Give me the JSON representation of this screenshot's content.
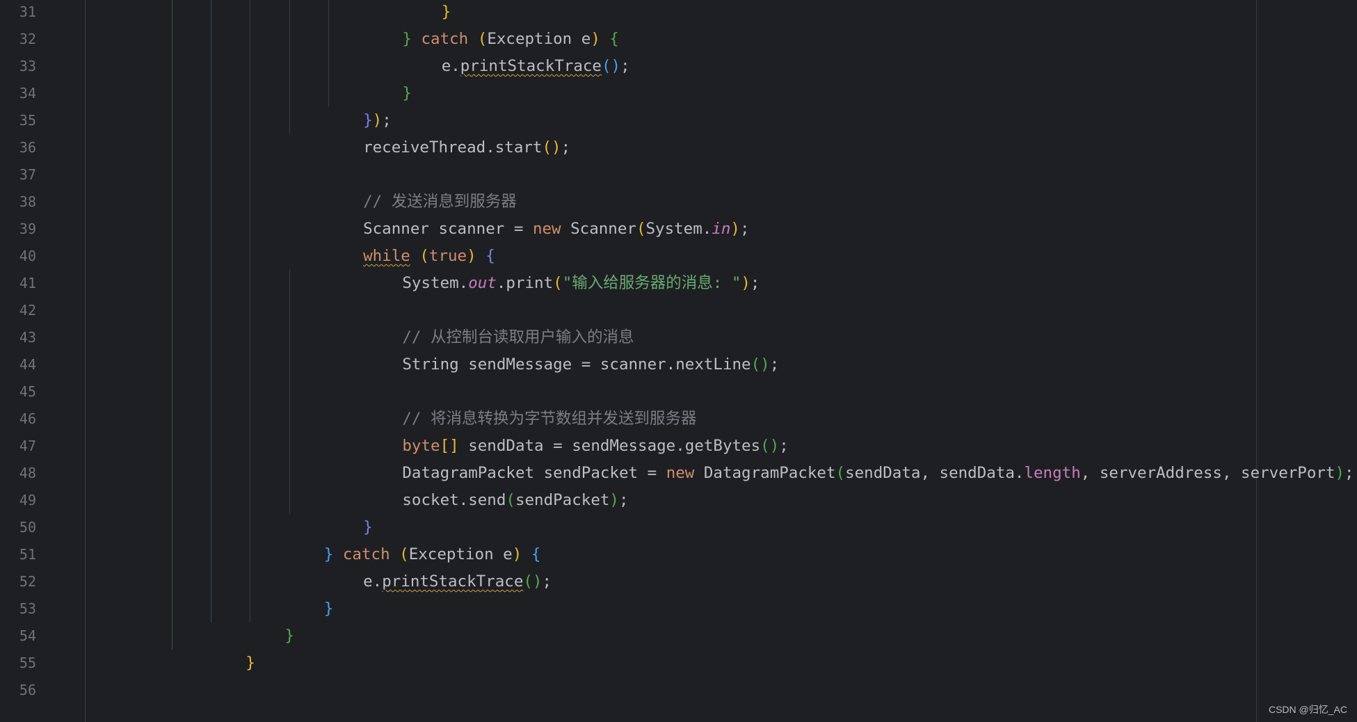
{
  "colors": {
    "background": "#1e1f22",
    "line_number": "#6f737a",
    "keyword": "#cf8e6d",
    "text": "#bcbec4",
    "string": "#6aab73",
    "comment": "#7a7e85",
    "static_field": "#c77dbb",
    "field": "#c77dbb",
    "brace_yellow": "#e8ba36",
    "brace_green": "#54a857",
    "brace_blue": "#4a9ff5",
    "brace_purple": "#7b83e6"
  },
  "editor": {
    "lines": [
      {
        "number": "31",
        "tokens": [
          {
            "text": "}",
            "class": "brace_yellow"
          }
        ]
      },
      {
        "number": "32",
        "tokens": [
          {
            "text": "} ",
            "class": "brace_green"
          },
          {
            "text": "catch ",
            "class": "keyword"
          },
          {
            "text": "(",
            "class": "brace_yellow"
          },
          {
            "text": "Exception e",
            "class": "text"
          },
          {
            "text": ") ",
            "class": "brace_yellow"
          },
          {
            "text": "{",
            "class": "brace_green"
          }
        ]
      },
      {
        "number": "33",
        "tokens": [
          {
            "text": "e.",
            "class": "text"
          },
          {
            "text": "printStackTrace",
            "class": "text",
            "squiggle": true
          },
          {
            "text": "()",
            "class": "brace_blue"
          },
          {
            "text": ";",
            "class": "text"
          }
        ]
      },
      {
        "number": "34",
        "tokens": [
          {
            "text": "}",
            "class": "brace_green"
          }
        ]
      },
      {
        "number": "35",
        "tokens": [
          {
            "text": "}",
            "class": "brace_purple"
          },
          {
            "text": ")",
            "class": "brace_yellow"
          },
          {
            "text": ";",
            "class": "text"
          }
        ]
      },
      {
        "number": "36",
        "tokens": [
          {
            "text": "receiveThread.start",
            "class": "text"
          },
          {
            "text": "()",
            "class": "brace_yellow"
          },
          {
            "text": ";",
            "class": "text"
          }
        ]
      },
      {
        "number": "37",
        "tokens": []
      },
      {
        "number": "38",
        "tokens": [
          {
            "text": "// 发送消息到服务器",
            "class": "comment"
          }
        ]
      },
      {
        "number": "39",
        "tokens": [
          {
            "text": "Scanner scanner = ",
            "class": "text"
          },
          {
            "text": "new ",
            "class": "keyword"
          },
          {
            "text": "Scanner",
            "class": "text"
          },
          {
            "text": "(",
            "class": "brace_yellow"
          },
          {
            "text": "System.",
            "class": "text"
          },
          {
            "text": "in",
            "class": "static_field",
            "italic": true
          },
          {
            "text": ")",
            "class": "brace_yellow"
          },
          {
            "text": ";",
            "class": "text"
          }
        ]
      },
      {
        "number": "40",
        "tokens": [
          {
            "text": "while",
            "class": "keyword",
            "squiggle": true
          },
          {
            "text": " ",
            "class": "text"
          },
          {
            "text": "(",
            "class": "brace_yellow"
          },
          {
            "text": "true",
            "class": "keyword"
          },
          {
            "text": ") ",
            "class": "brace_yellow"
          },
          {
            "text": "{",
            "class": "brace_purple"
          }
        ]
      },
      {
        "number": "41",
        "tokens": [
          {
            "text": "System.",
            "class": "text"
          },
          {
            "text": "out",
            "class": "static_field",
            "italic": true
          },
          {
            "text": ".print",
            "class": "text"
          },
          {
            "text": "(",
            "class": "brace_yellow"
          },
          {
            "text": "\"输入给服务器的消息: \"",
            "class": "string"
          },
          {
            "text": ")",
            "class": "brace_yellow"
          },
          {
            "text": ";",
            "class": "text"
          }
        ]
      },
      {
        "number": "42",
        "tokens": []
      },
      {
        "number": "43",
        "tokens": [
          {
            "text": "// 从控制台读取用户输入的消息",
            "class": "comment"
          }
        ]
      },
      {
        "number": "44",
        "tokens": [
          {
            "text": "String sendMessage = scanner.nextLine",
            "class": "text"
          },
          {
            "text": "()",
            "class": "brace_green"
          },
          {
            "text": ";",
            "class": "text"
          }
        ]
      },
      {
        "number": "45",
        "tokens": []
      },
      {
        "number": "46",
        "tokens": [
          {
            "text": "// 将消息转换为字节数组并发送到服务器",
            "class": "comment"
          }
        ]
      },
      {
        "number": "47",
        "tokens": [
          {
            "text": "byte",
            "class": "keyword"
          },
          {
            "text": "[]",
            "class": "brace_yellow"
          },
          {
            "text": " sendData = sendMessage.getBytes",
            "class": "text"
          },
          {
            "text": "()",
            "class": "brace_green"
          },
          {
            "text": ";",
            "class": "text"
          }
        ]
      },
      {
        "number": "48",
        "tokens": [
          {
            "text": "DatagramPacket sendPacket = ",
            "class": "text"
          },
          {
            "text": "new ",
            "class": "keyword"
          },
          {
            "text": "DatagramPacket",
            "class": "text"
          },
          {
            "text": "(",
            "class": "brace_green"
          },
          {
            "text": "sendData, sendData.",
            "class": "text"
          },
          {
            "text": "length",
            "class": "field"
          },
          {
            "text": ", serverAddress, serverPort",
            "class": "text"
          },
          {
            "text": ")",
            "class": "brace_green"
          },
          {
            "text": ";",
            "class": "text"
          }
        ]
      },
      {
        "number": "49",
        "tokens": [
          {
            "text": "socket.send",
            "class": "text"
          },
          {
            "text": "(",
            "class": "brace_green"
          },
          {
            "text": "sendPacket",
            "class": "text"
          },
          {
            "text": ")",
            "class": "brace_green"
          },
          {
            "text": ";",
            "class": "text"
          }
        ]
      },
      {
        "number": "50",
        "tokens": [
          {
            "text": "}",
            "class": "brace_purple"
          }
        ]
      },
      {
        "number": "51",
        "tokens": [
          {
            "text": "} ",
            "class": "brace_blue"
          },
          {
            "text": "catch ",
            "class": "keyword"
          },
          {
            "text": "(",
            "class": "brace_yellow"
          },
          {
            "text": "Exception e",
            "class": "text"
          },
          {
            "text": ") ",
            "class": "brace_yellow"
          },
          {
            "text": "{",
            "class": "brace_blue"
          }
        ]
      },
      {
        "number": "52",
        "tokens": [
          {
            "text": "e.",
            "class": "text"
          },
          {
            "text": "printStackTrace",
            "class": "text",
            "squiggle": true
          },
          {
            "text": "()",
            "class": "brace_green"
          },
          {
            "text": ";",
            "class": "text"
          }
        ]
      },
      {
        "number": "53",
        "tokens": [
          {
            "text": "}",
            "class": "brace_blue"
          }
        ]
      },
      {
        "number": "54",
        "tokens": [
          {
            "text": "}",
            "class": "brace_green"
          }
        ]
      },
      {
        "number": "55",
        "tokens": [
          {
            "text": "}",
            "class": "brace_yellow"
          }
        ]
      },
      {
        "number": "56",
        "tokens": []
      }
    ]
  },
  "watermark": {
    "text": "CSDN @归忆_AC"
  }
}
